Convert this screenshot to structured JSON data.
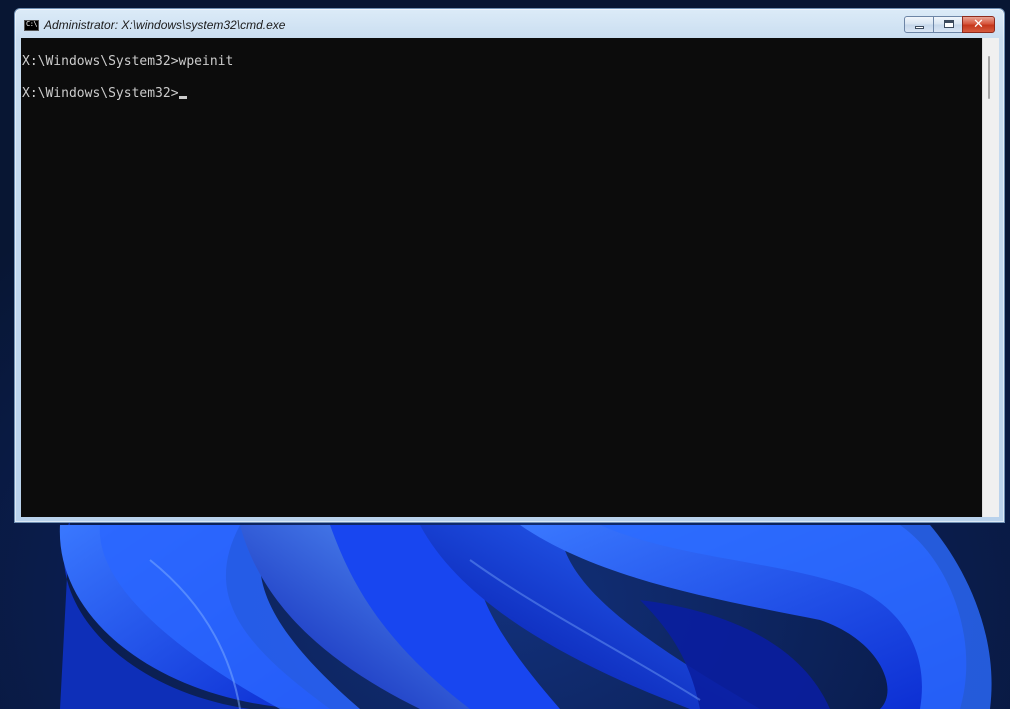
{
  "window": {
    "title": "Administrator: X:\\windows\\system32\\cmd.exe",
    "icon_label": "C:\\",
    "icon": "cmd-icon",
    "buttons": {
      "minimize": "minimize-icon",
      "maximize": "maximize-icon",
      "close": "close-icon"
    }
  },
  "console": {
    "lines": [
      "X:\\Windows\\System32>wpeinit",
      "X:\\Windows\\System32>"
    ],
    "background": "#0c0c0c",
    "foreground": "#cccccc"
  },
  "colors": {
    "desktop_background": "#0a1a3a",
    "wallpaper_accent": "#1e4cff"
  }
}
